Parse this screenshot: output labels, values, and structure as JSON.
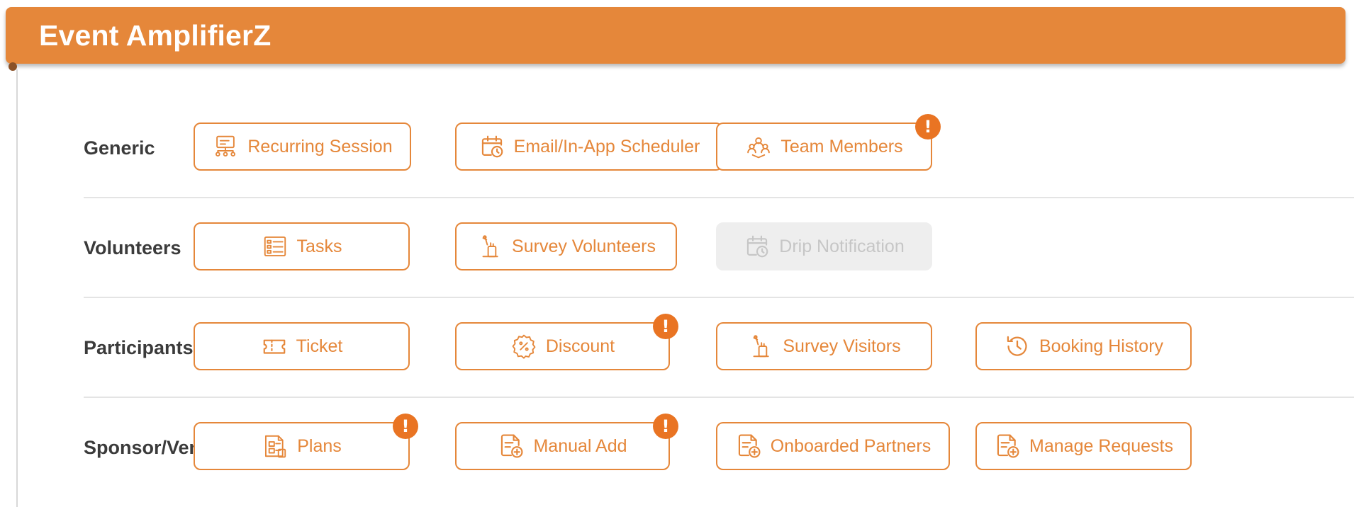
{
  "app": {
    "title": "Event AmplifierZ"
  },
  "colors": {
    "accent": "#E5873A",
    "alert": "#E97423",
    "disabled_bg": "#EEEEEE",
    "disabled_text": "#C6C6C6",
    "label_text": "#3B3B3B"
  },
  "alert_glyph": "!",
  "sections": [
    {
      "label": "Generic",
      "items": [
        {
          "label": "Recurring Session",
          "icon": "recurring-session-icon",
          "alert": false,
          "disabled": false
        },
        {
          "label": "Email/In-App Scheduler",
          "icon": "calendar-clock-icon",
          "alert": false,
          "disabled": false
        },
        {
          "label": "Team Members",
          "icon": "team-members-icon",
          "alert": true,
          "disabled": false
        }
      ]
    },
    {
      "label": "Volunteers",
      "items": [
        {
          "label": "Tasks",
          "icon": "tasks-icon",
          "alert": false,
          "disabled": false
        },
        {
          "label": "Survey Volunteers",
          "icon": "survey-icon",
          "alert": false,
          "disabled": false
        },
        {
          "label": "Drip Notification",
          "icon": "calendar-clock-icon",
          "alert": false,
          "disabled": true
        }
      ]
    },
    {
      "label": "Participants",
      "items": [
        {
          "label": "Ticket",
          "icon": "ticket-icon",
          "alert": false,
          "disabled": false
        },
        {
          "label": "Discount",
          "icon": "discount-icon",
          "alert": true,
          "disabled": false
        },
        {
          "label": "Survey Visitors",
          "icon": "survey-icon",
          "alert": false,
          "disabled": false
        },
        {
          "label": "Booking History",
          "icon": "history-icon",
          "alert": false,
          "disabled": false
        }
      ]
    },
    {
      "label": "Sponsor/Vendor",
      "items": [
        {
          "label": "Plans",
          "icon": "plans-icon",
          "alert": true,
          "disabled": false
        },
        {
          "label": "Manual Add",
          "icon": "document-add-icon",
          "alert": true,
          "disabled": false
        },
        {
          "label": "Onboarded Partners",
          "icon": "document-add-icon",
          "alert": false,
          "disabled": false
        },
        {
          "label": "Manage Requests",
          "icon": "document-add-icon",
          "alert": false,
          "disabled": false
        }
      ]
    }
  ]
}
